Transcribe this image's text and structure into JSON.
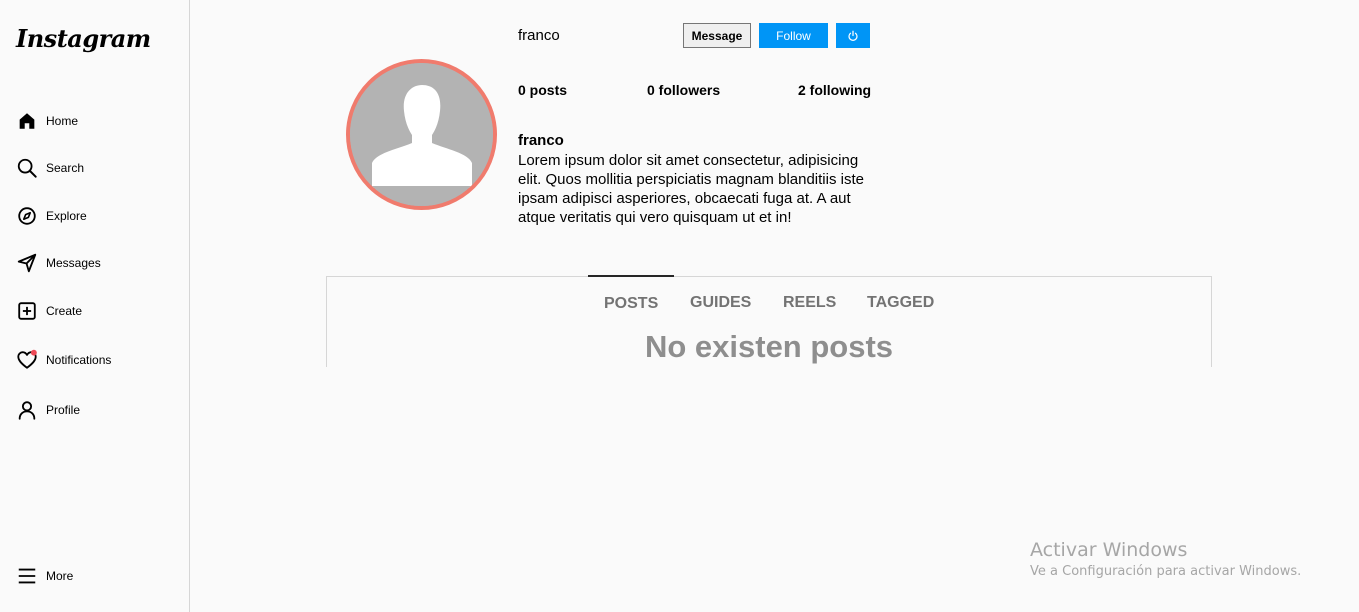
{
  "sidebar": {
    "logo": "Instagram",
    "items": [
      {
        "label": "Home",
        "icon": "home-icon"
      },
      {
        "label": "Search",
        "icon": "search-icon"
      },
      {
        "label": "Explore",
        "icon": "compass-icon"
      },
      {
        "label": "Messages",
        "icon": "send-icon"
      },
      {
        "label": "Create",
        "icon": "plus-square-icon"
      },
      {
        "label": "Notifications",
        "icon": "heart-icon"
      },
      {
        "label": "Profile",
        "icon": "user-icon"
      }
    ],
    "more_label": "More"
  },
  "profile": {
    "username": "franco",
    "message_button": "Message",
    "follow_button": "Follow",
    "stats": {
      "posts": "0 posts",
      "followers": "0 followers",
      "following": "2 following"
    },
    "bio_name": "franco",
    "bio_text": "Lorem ipsum dolor sit amet consectetur, adipisicing elit. Quos mollitia perspiciatis magnam blanditiis iste ipsam adipisci asperiores, obcaecati fuga at. A aut atque veritatis qui vero quisquam ut et in!"
  },
  "tabs": {
    "items": [
      "POSTS",
      "GUIDES",
      "REELS",
      "TAGGED"
    ],
    "active": "POSTS",
    "empty_message": "No existen posts"
  },
  "watermark": {
    "title": "Activar Windows",
    "subtitle": "Ve a Configuración para activar Windows."
  },
  "colors": {
    "accent": "#0095f6",
    "avatar_ring": "#f07b6d",
    "notification_dot": "#ed4956"
  }
}
